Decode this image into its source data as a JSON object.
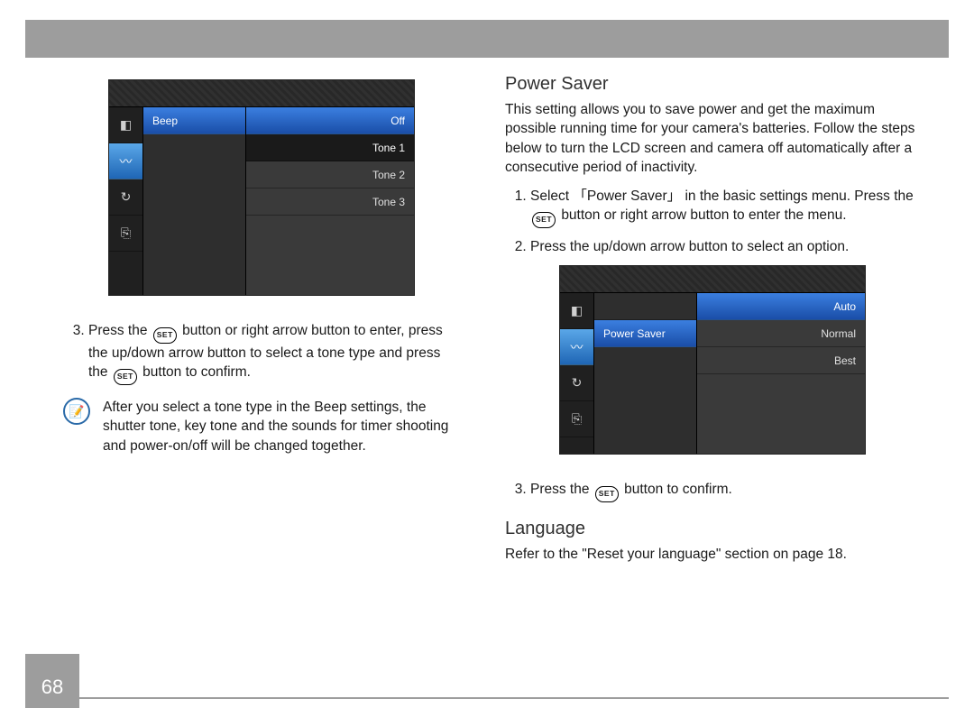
{
  "page_number": "68",
  "left": {
    "menu": {
      "selected_item": "Beep",
      "options": [
        "Off",
        "Tone 1",
        "Tone 2",
        "Tone 3"
      ],
      "selected_option": "Off"
    },
    "step3_a": "Press the ",
    "step3_b": " button or right arrow button to enter, press the up/down arrow button to select a tone type and press the ",
    "step3_c": " button to confirm.",
    "note": "After you select a tone type in the Beep settings, the shutter tone, key tone and the sounds for timer shooting and power-on/off will be changed together."
  },
  "right": {
    "title_power": "Power Saver",
    "power_intro": "This setting allows you to save power and get the maximum possible running time for your camera's batteries. Follow the steps below to turn the LCD screen and camera off automatically after a consecutive period of inactivity.",
    "step1_a": "Select",
    "step1_menuitem": "Power Saver",
    "step1_b": "in the basic settings menu. Press the ",
    "step1_c": " button or right arrow button to enter the menu.",
    "step2": "Press the up/down arrow button to select an option.",
    "power_menu": {
      "selected_item": "Power Saver",
      "options": [
        "Auto",
        "Normal",
        "Best"
      ],
      "selected_option": "Auto"
    },
    "step3_a": "Press the ",
    "step3_b": " button to confirm.",
    "title_lang": "Language",
    "lang_text": "Refer to the \"Reset your language\" section on page 18."
  },
  "labels": {
    "set": "SET"
  }
}
